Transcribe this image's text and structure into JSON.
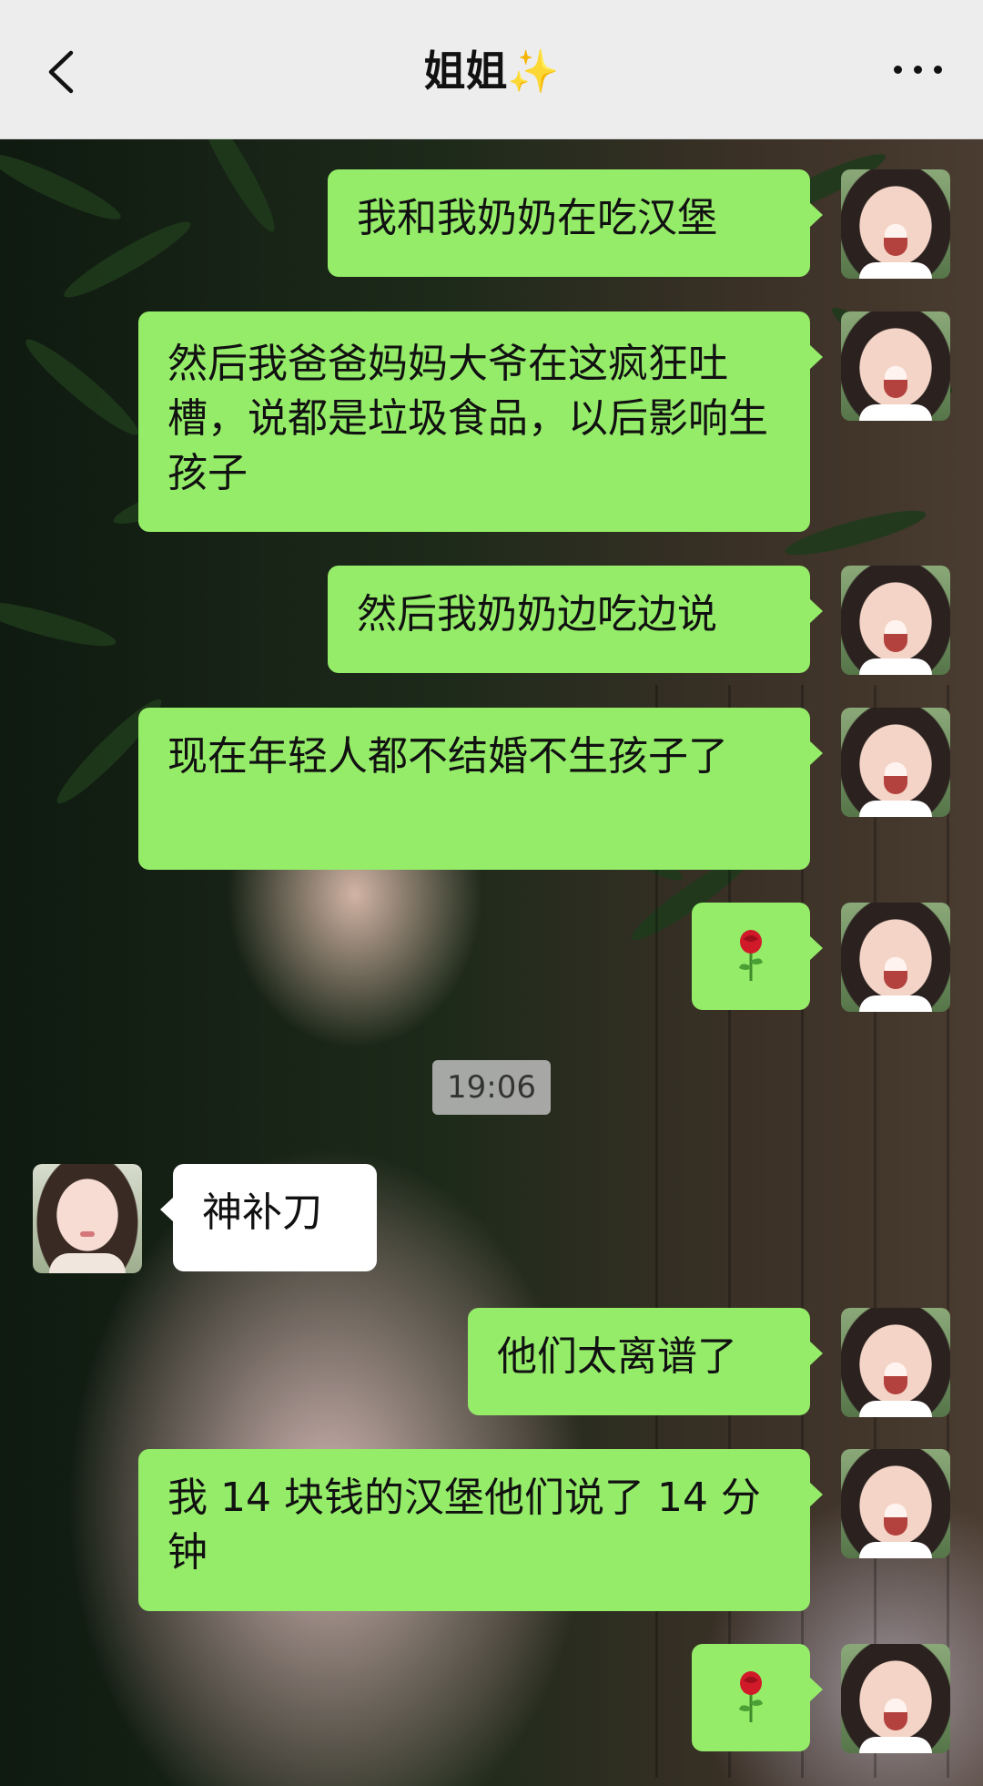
{
  "header": {
    "title": "姐姐",
    "title_emoji": "✨"
  },
  "messages": [
    {
      "side": "me",
      "text": "我和我奶奶在吃汉堡"
    },
    {
      "side": "me",
      "text": "然后我爸爸妈妈大爷在这疯狂吐槽，说都是垃圾食品，以后影响生孩子"
    },
    {
      "side": "me",
      "text": "然后我奶奶边吃边说"
    },
    {
      "side": "me",
      "text": "现在年轻人都不结婚不生孩子了"
    },
    {
      "side": "me",
      "sticker": "rose-emoji"
    },
    {
      "timestamp": "19:06"
    },
    {
      "side": "other",
      "text": "神补刀"
    },
    {
      "side": "me",
      "text": "他们太离谱了"
    },
    {
      "side": "me",
      "text": "我 14 块钱的汉堡他们说了 14 分钟"
    },
    {
      "side": "me",
      "sticker": "rose-emoji"
    }
  ],
  "colors": {
    "header_bg": "#ededed",
    "my_bubble": "#95ec69",
    "their_bubble": "#ffffff",
    "timestamp_bg": "#c8c8c8"
  },
  "icons": [
    "back-chevron-icon",
    "more-dots-icon",
    "rose-emoji"
  ]
}
